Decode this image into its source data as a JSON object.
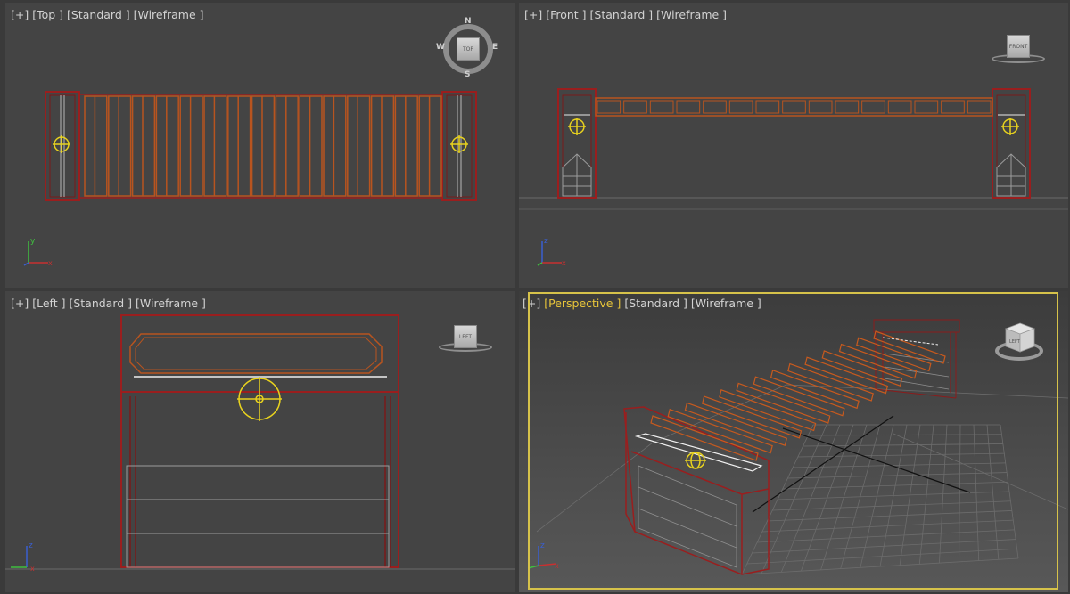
{
  "viewports": {
    "top": {
      "plus": "[+]",
      "view": "[Top ]",
      "shading": "[Standard ]",
      "mode": "[Wireframe ]",
      "cube_text": "TOP",
      "compass": {
        "n": "N",
        "s": "S",
        "e": "E",
        "w": "W"
      }
    },
    "front": {
      "plus": "[+]",
      "view": "[Front ]",
      "shading": "[Standard ]",
      "mode": "[Wireframe ]",
      "cube_text": "FRONT"
    },
    "left": {
      "plus": "[+]",
      "view": "[Left ]",
      "shading": "[Standard ]",
      "mode": "[Wireframe ]",
      "cube_text": "LEFT"
    },
    "perspective": {
      "plus": "[+]",
      "view": "[Perspective ]",
      "shading": "[Standard ]",
      "mode": "[Wireframe ]",
      "cube_text": "LEFT",
      "active": true
    }
  },
  "axes": {
    "x": "x",
    "y": "y",
    "z": "z"
  },
  "colors": {
    "viewport_bg": "#444444",
    "divider": "#3a3a3a",
    "frame_red": "#9a1e1e",
    "slat_orange": "#b8541f",
    "gizmo_yellow": "#e8d21e",
    "active_border": "#d6c24a",
    "grid": "#6a6a6a"
  }
}
